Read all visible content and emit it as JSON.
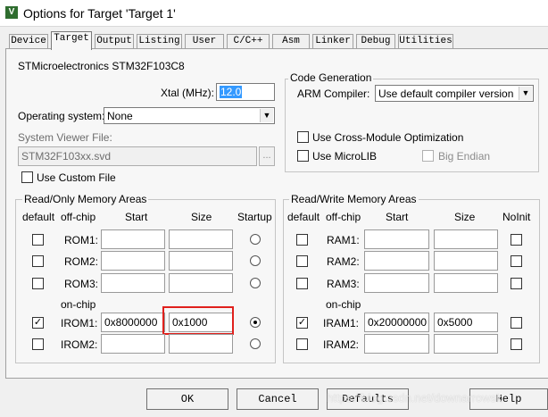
{
  "window": {
    "title": "Options for Target 'Target 1'",
    "icon": "keil-icon"
  },
  "tabs": [
    "Device",
    "Target",
    "Output",
    "Listing",
    "User",
    "C/C++",
    "Asm",
    "Linker",
    "Debug",
    "Utilities"
  ],
  "active_tab": "Target",
  "device": {
    "name": "STMicroelectronics STM32F103C8",
    "xtal_label": "Xtal (MHz):",
    "xtal_value": "12.0",
    "os_label": "Operating system:",
    "os_value": "None",
    "svf_label": "System Viewer File:",
    "svf_value": "STM32F103xx.svd",
    "svf_browse": "...",
    "use_custom_file": "Use Custom File"
  },
  "code_generation": {
    "title": "Code Generation",
    "arm_compiler_label": "ARM Compiler:",
    "arm_compiler_value": "Use default compiler version",
    "cross_module": "Use Cross-Module Optimization",
    "microlib": "Use MicroLIB",
    "big_endian": "Big Endian"
  },
  "rom_areas": {
    "title": "Read/Only Memory Areas",
    "headers": {
      "default": "default",
      "offchip": "off-chip",
      "start": "Start",
      "size": "Size",
      "startup": "Startup"
    },
    "onchip_label": "on-chip",
    "rows": [
      {
        "label": "ROM1:",
        "start": "",
        "size": "",
        "default": false,
        "startup": false
      },
      {
        "label": "ROM2:",
        "start": "",
        "size": "",
        "default": false,
        "startup": false
      },
      {
        "label": "ROM3:",
        "start": "",
        "size": "",
        "default": false,
        "startup": false
      },
      {
        "label": "IROM1:",
        "start": "0x8000000",
        "size": "0x1000",
        "default": true,
        "startup": true
      },
      {
        "label": "IROM2:",
        "start": "",
        "size": "",
        "default": false,
        "startup": false
      }
    ]
  },
  "ram_areas": {
    "title": "Read/Write Memory Areas",
    "headers": {
      "default": "default",
      "offchip": "off-chip",
      "start": "Start",
      "size": "Size",
      "noinit": "NoInit"
    },
    "onchip_label": "on-chip",
    "rows": [
      {
        "label": "RAM1:",
        "start": "",
        "size": "",
        "default": false
      },
      {
        "label": "RAM2:",
        "start": "",
        "size": "",
        "default": false
      },
      {
        "label": "RAM3:",
        "start": "",
        "size": "",
        "default": false
      },
      {
        "label": "IRAM1:",
        "start": "0x20000000",
        "size": "0x5000",
        "default": true
      },
      {
        "label": "IRAM2:",
        "start": "",
        "size": "",
        "default": false
      }
    ]
  },
  "buttons": {
    "ok": "OK",
    "cancel": "Cancel",
    "defaults": "Defaults",
    "help": "Help"
  },
  "watermark": "https://blog.csdn.net/downarrowsk",
  "colors": {
    "highlight": "#e0201c",
    "selection": "#3399ff"
  }
}
